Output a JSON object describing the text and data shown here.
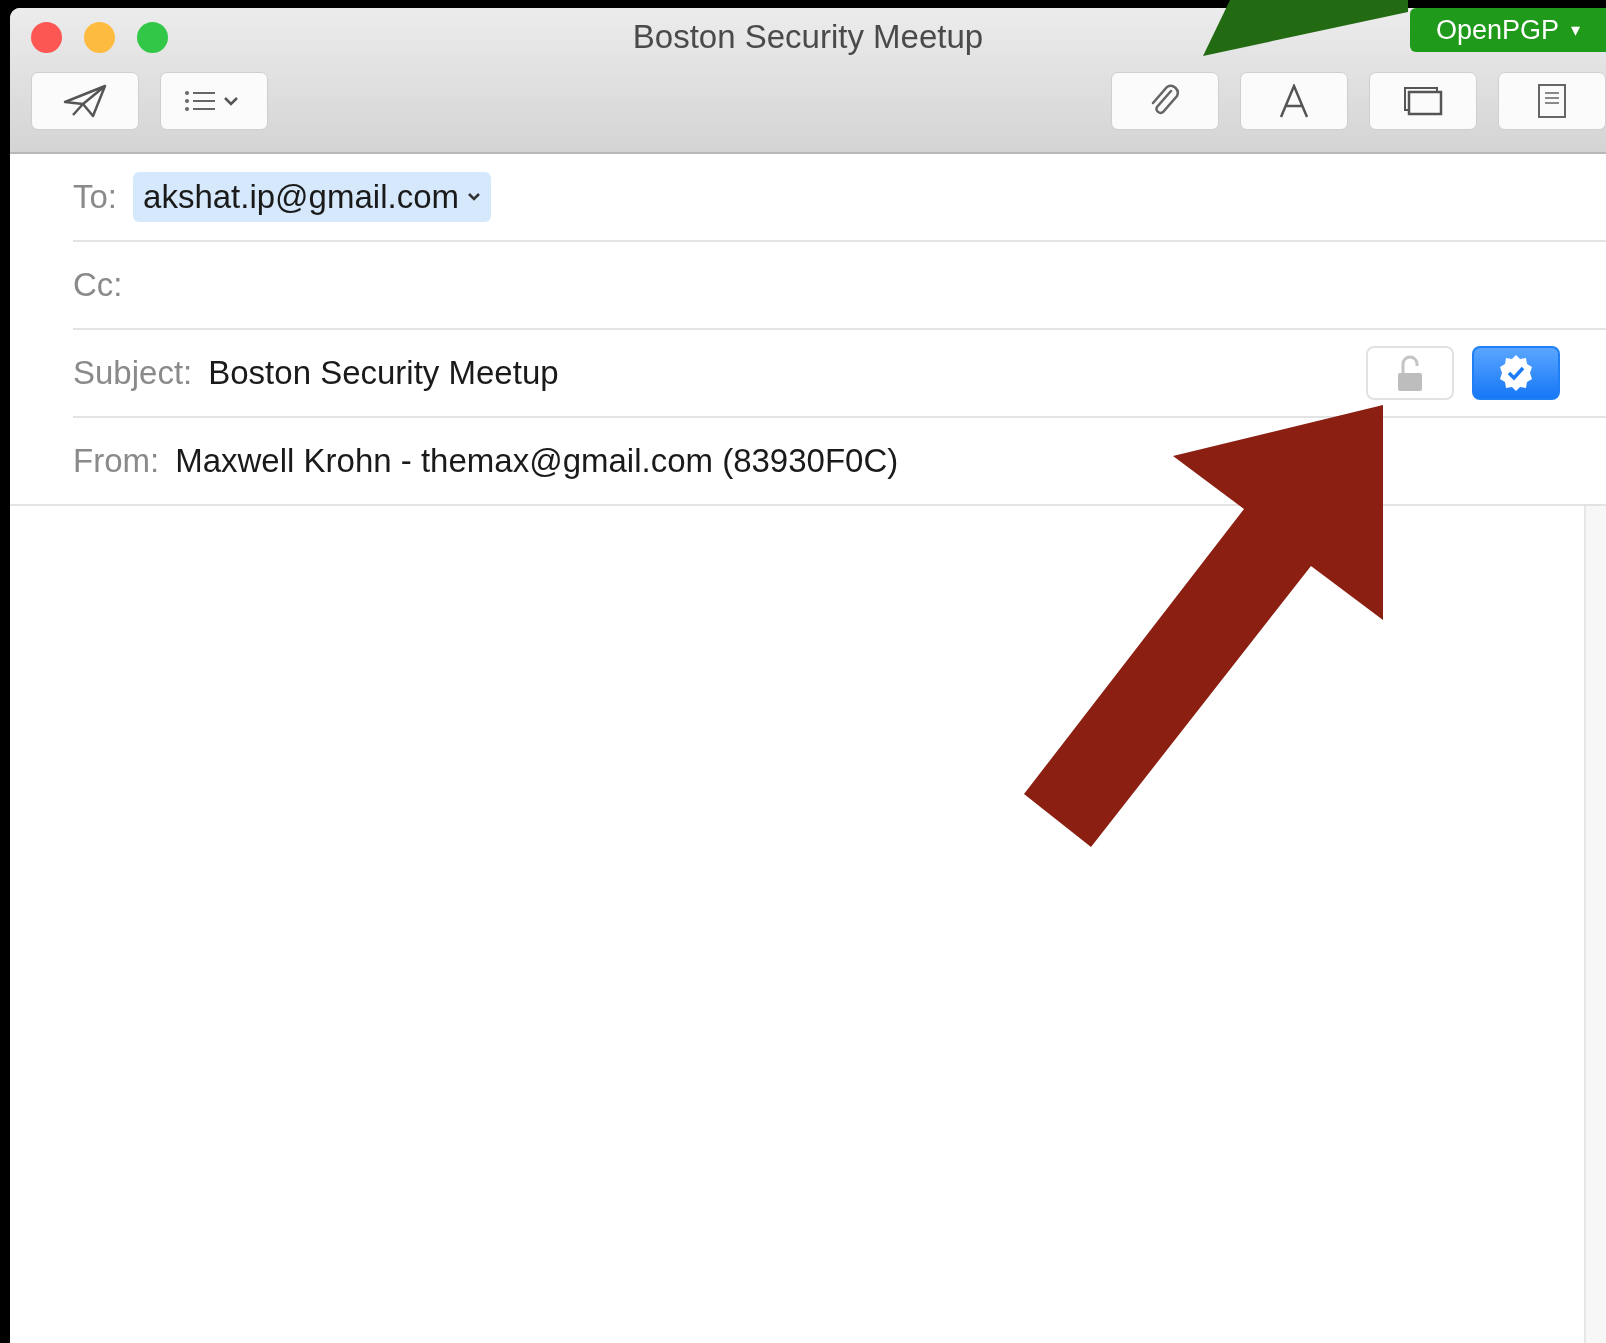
{
  "window": {
    "title": "Boston Security Meetup"
  },
  "openpgp_button": {
    "label": "OpenPGP",
    "caret": "▾"
  },
  "header": {
    "to": {
      "label": "To:",
      "recipients": [
        {
          "address": "akshat.ip@gmail.com",
          "selected": true
        }
      ]
    },
    "cc": {
      "label": "Cc:"
    },
    "subject": {
      "label": "Subject:",
      "value": "Boston Security Meetup"
    },
    "encrypt": {
      "on": false
    },
    "sign": {
      "on": true
    },
    "from": {
      "label": "From:",
      "value": "Maxwell Krohn - themax@gmail.com (83930F0C)"
    }
  }
}
